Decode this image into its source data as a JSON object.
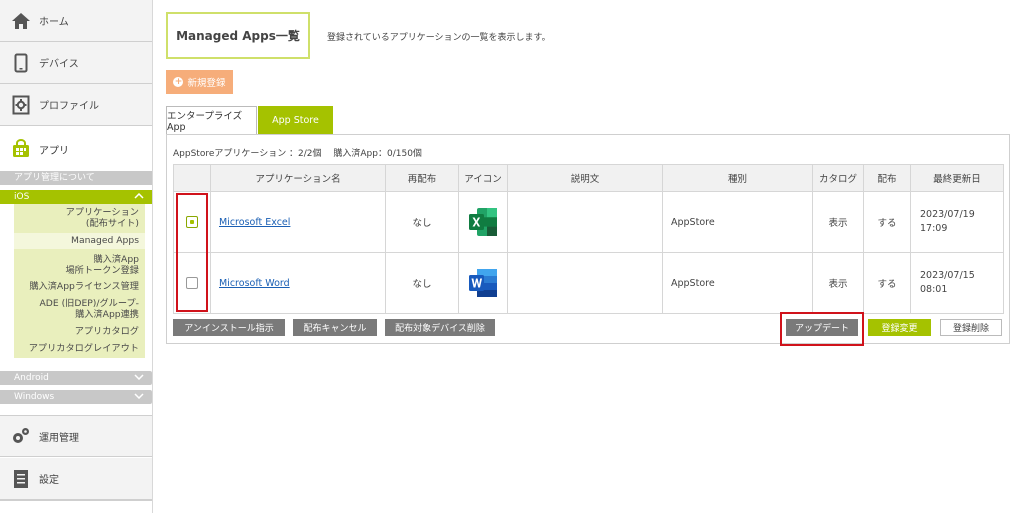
{
  "sidebar": {
    "home": "ホーム",
    "device": "デバイス",
    "profile": "プロファイル",
    "app": "アプリ",
    "app_about": "アプリ管理について",
    "ios": {
      "label": "iOS",
      "items": [
        "アプリケーション\n(配布サイト)",
        "Managed Apps",
        "購入済App\n場所トークン登録",
        "購入済Appライセンス管理",
        "ADE (旧DEP)/グループ-\n購入済App連携",
        "アプリカタログ",
        "アプリカタログレイアウト"
      ]
    },
    "android": "Android",
    "windows": "Windows",
    "ops": "運用管理",
    "settings": "設定"
  },
  "header": {
    "title": "Managed Apps一覧",
    "description": "登録されているアプリケーションの一覧を表示します。"
  },
  "new_button": "新規登録",
  "tabs": [
    {
      "label": "エンタープライズApp"
    },
    {
      "label": "App Store"
    }
  ],
  "counts": {
    "text": "AppStoreアプリケーション ：2/2個　 購入済App：0/150個"
  },
  "table": {
    "headers": [
      "",
      "アプリケーション名",
      "再配布",
      "アイコン",
      "説明文",
      "種別",
      "カタログ",
      "配布",
      "最終更新日"
    ],
    "rows": [
      {
        "checked": true,
        "name": "Microsoft Excel",
        "redist": "なし",
        "icon": "excel-icon",
        "desc": "",
        "type": "AppStore",
        "catalog": "表示",
        "distribute": "する",
        "date": "2023/07/19",
        "time": "17:09"
      },
      {
        "checked": false,
        "name": "Microsoft Word",
        "redist": "なし",
        "icon": "word-icon",
        "desc": "",
        "type": "AppStore",
        "catalog": "表示",
        "distribute": "する",
        "date": "2023/07/15",
        "time": "08:01"
      }
    ]
  },
  "actions": {
    "uninstall": "アンインストール指示",
    "cancel": "配布キャンセル",
    "remove_target": "配布対象デバイス削除",
    "update": "アップデート",
    "modify": "登録変更",
    "delete": "登録削除"
  },
  "colors": {
    "accent": "#a5c200",
    "new_button": "#f6ad7a",
    "highlight": "#d0121b"
  }
}
